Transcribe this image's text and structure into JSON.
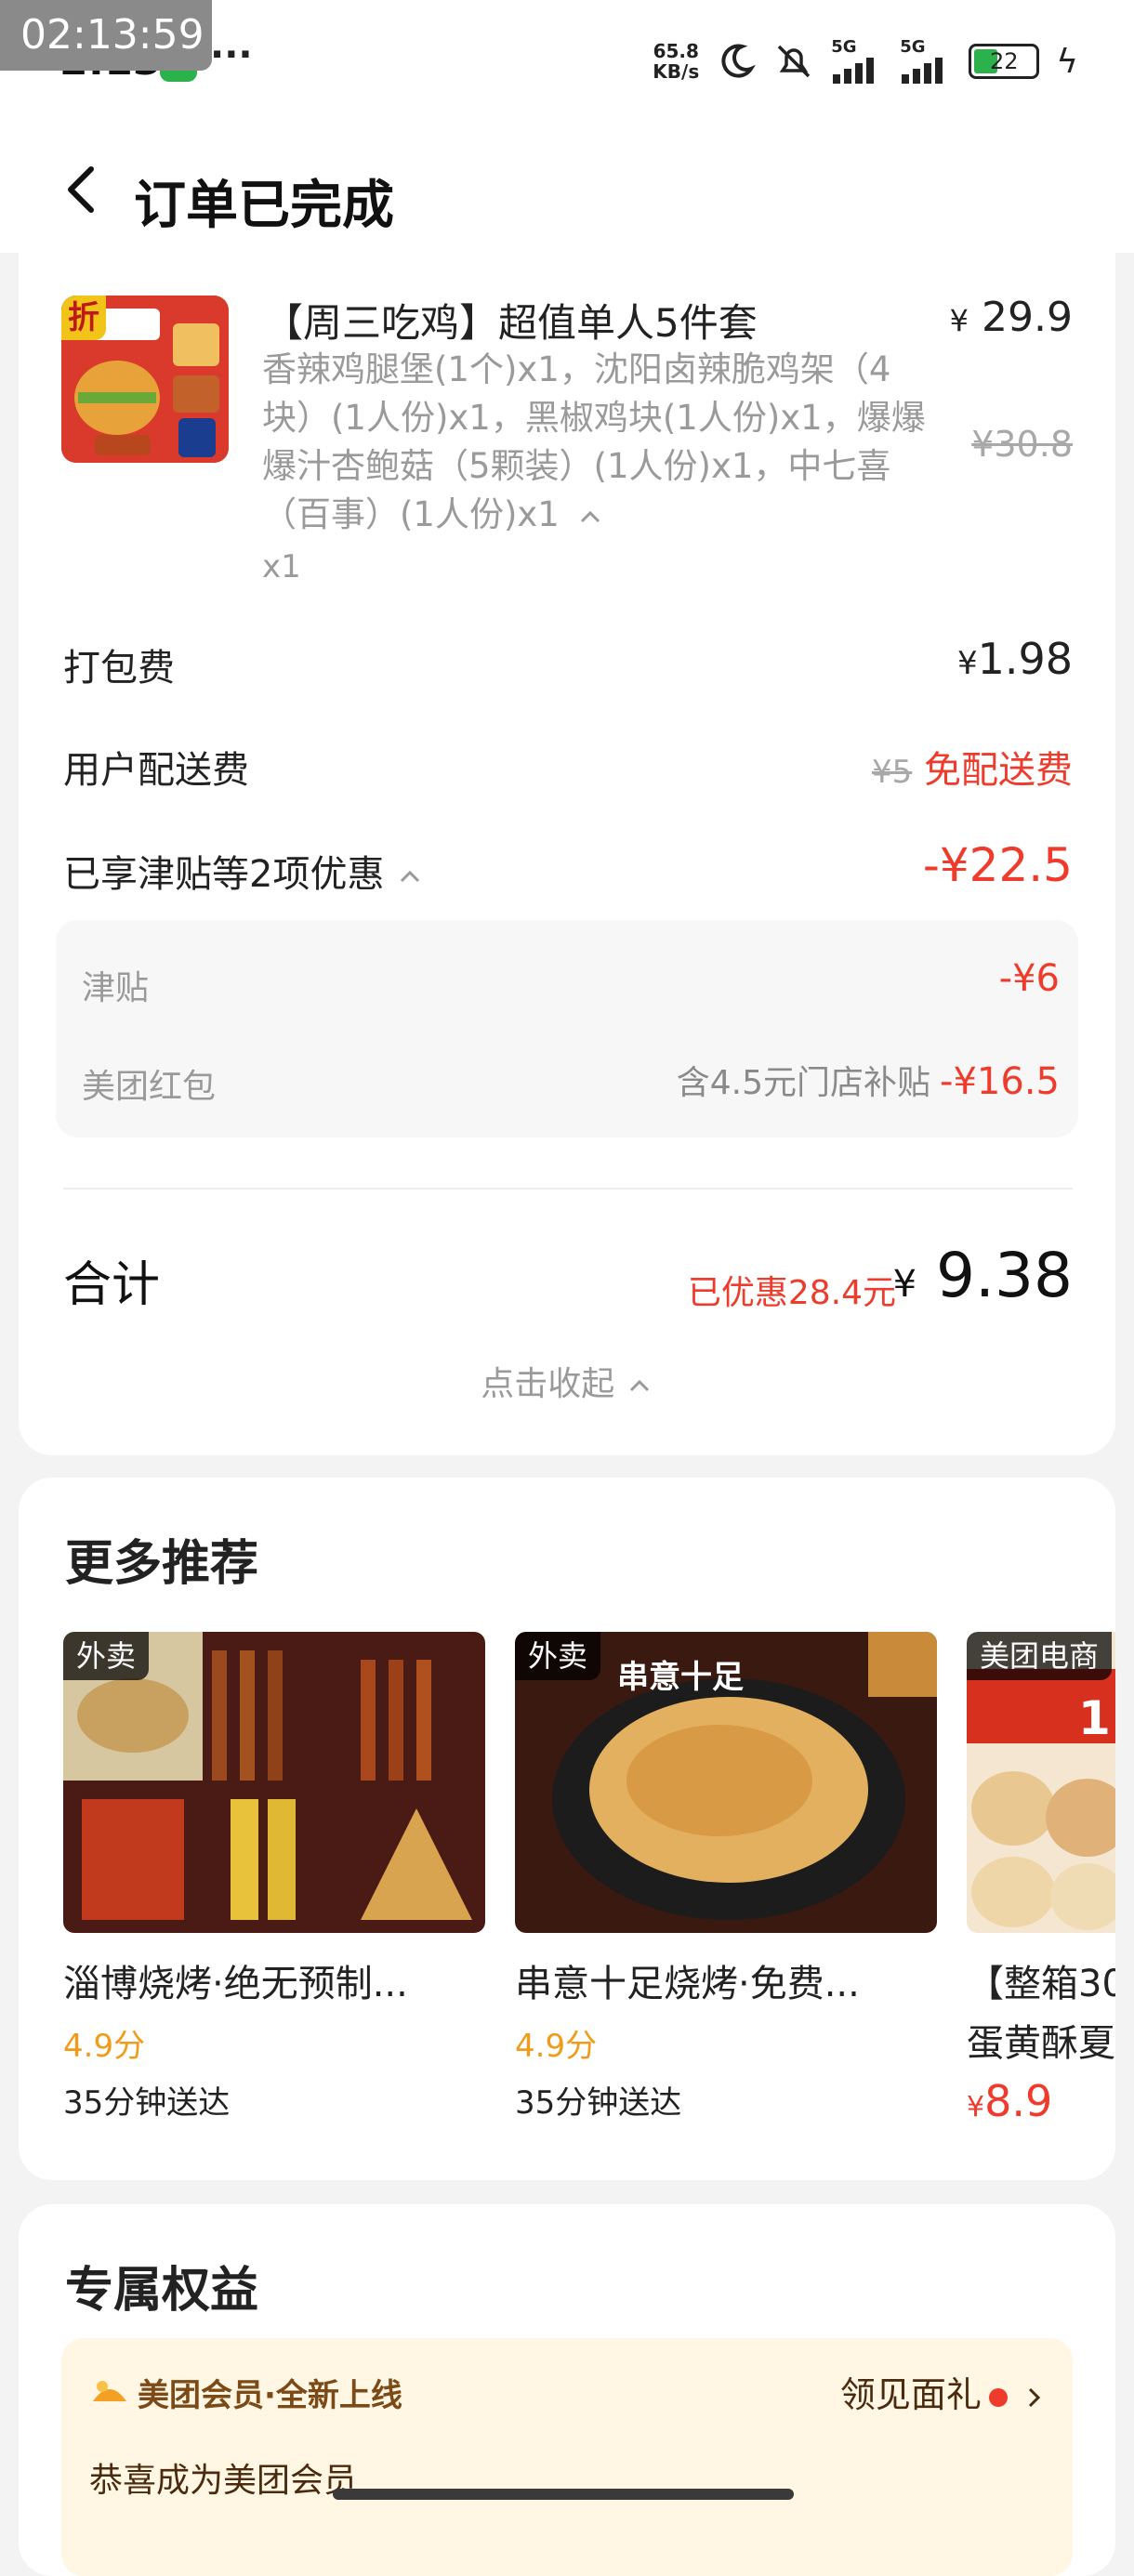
{
  "status_bar": {
    "timer_overlay": "02:13:59",
    "time": "2:13",
    "more": "···",
    "speed_line1": "65.8",
    "speed_line2": "KB/s",
    "sig1": "5G",
    "sig2": "5G",
    "battery": "22"
  },
  "header": {
    "title": "订单已完成"
  },
  "order_item": {
    "thumb_tag": "折",
    "name": "【周三吃鸡】超值单人5件套",
    "desc": "香辣鸡腿堡(1个)x1，沈阳卤辣脆鸡架（4块）(1人份)x1，黑椒鸡块(1人份)x1，爆爆爆汁杏鲍菇（5颗装）(1人份)x1，中七喜（百事）(1人份)x1",
    "qty": "x1",
    "price_symbol": "¥",
    "price": "29.9",
    "orig_price": "¥30.8"
  },
  "fees": {
    "packing_label": "打包费",
    "packing_symbol": "¥",
    "packing_value": "1.98",
    "delivery_label": "用户配送费",
    "delivery_orig": "¥5",
    "delivery_value": "免配送费",
    "discounts_label": "已享津贴等2项优惠",
    "discounts_value": "-¥22.5"
  },
  "discount_details": [
    {
      "label": "津贴",
      "note": "",
      "value": "-¥6"
    },
    {
      "label": "美团红包",
      "note": "含4.5元门店补贴",
      "value": "-¥16.5"
    }
  ],
  "total": {
    "label": "合计",
    "saved": "已优惠28.4元",
    "symbol": "¥",
    "value": "9.38",
    "collapse": "点击收起"
  },
  "recommendations": {
    "title": "更多推荐",
    "items": [
      {
        "tag": "外卖",
        "name": "淄博烧烤·绝无预制...",
        "rating": "4.9分",
        "delivery": "35分钟送达"
      },
      {
        "tag": "外卖",
        "name": "串意十足烧烤·免费...",
        "rating": "4.9分",
        "delivery": "35分钟送达",
        "img_text": "串意十足"
      },
      {
        "tag": "美团电商",
        "name": "【整箱30",
        "name2": "蛋黄酥夏",
        "price_symbol": "¥",
        "price": "8.9",
        "img_text": "1"
      }
    ]
  },
  "benefits": {
    "title": "专属权益",
    "member_title": "美团会员·全新上线",
    "member_link": "领见面礼",
    "member_sub": "恭喜成为美团会员"
  },
  "colors": {
    "accent_red": "#ee3b2b",
    "rating_orange": "#f29a1a",
    "muted_gray": "#9a9a9a"
  }
}
